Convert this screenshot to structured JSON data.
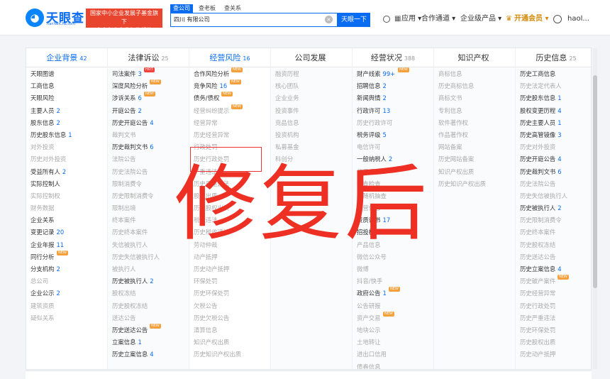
{
  "header": {
    "logo_glyph": "◕",
    "brand": "天眼查",
    "brand_sub": "TianYanCha.com",
    "badge_line1": "国家中小企业发展子基金旗下",
    "badge_line2": "官方备案企业征信机构",
    "search_tabs": [
      "查公司",
      "查老板",
      "查关系"
    ],
    "search_value": "四川                    有限公司",
    "search_button": "天眼一下",
    "nav": {
      "apps": "应用 ▾",
      "cooperation": "合作通道 ▾",
      "enterprise": "企业级产品 ▾",
      "vip": "开通会员 ▾",
      "user": "haol..."
    }
  },
  "columns": [
    {
      "title": "企业背景",
      "count": "42",
      "active": true,
      "items": [
        {
          "label": "天眼图谱"
        },
        {
          "label": "工商信息"
        },
        {
          "label": "天眼风险"
        },
        {
          "label": "主要人员",
          "count": "2"
        },
        {
          "label": "股东信息",
          "count": "2"
        },
        {
          "label": "历史股东信息",
          "count": "1"
        },
        {
          "label": "对外投资",
          "dim": true
        },
        {
          "label": "历史对外投资",
          "dim": true
        },
        {
          "label": "受益所有人",
          "count": "2"
        },
        {
          "label": "实际控制人"
        },
        {
          "label": "实际控制权",
          "dim": true
        },
        {
          "label": "财务数据",
          "dim": true
        },
        {
          "label": "企业关系"
        },
        {
          "label": "变更记录",
          "count": "20"
        },
        {
          "label": "企业年报",
          "count": "11"
        },
        {
          "label": "同行分析",
          "tag": "NEW"
        },
        {
          "label": "分支机构",
          "count": "2"
        },
        {
          "label": "总公司",
          "dim": true
        },
        {
          "label": "企业公示",
          "count": "2"
        },
        {
          "label": "建筑资质",
          "dim": true
        },
        {
          "label": "疑似关系",
          "dim": true
        }
      ]
    },
    {
      "title": "法律诉讼",
      "count": "25",
      "active": false,
      "items": [
        {
          "label": "司法案件",
          "count": "3",
          "tag": "HOT",
          "hot": true
        },
        {
          "label": "深度风险分析",
          "tag": "NEW"
        },
        {
          "label": "涉诉关系",
          "count": "6",
          "tag": "NEW"
        },
        {
          "label": "开庭公告",
          "count": "2"
        },
        {
          "label": "历史开庭公告",
          "count": "4"
        },
        {
          "label": "裁判文书",
          "dim": true
        },
        {
          "label": "历史裁判文书",
          "count": "6"
        },
        {
          "label": "法院公告",
          "dim": true
        },
        {
          "label": "历史法院公告",
          "dim": true
        },
        {
          "label": "限制消费令",
          "dim": true
        },
        {
          "label": "历史限制消费令",
          "dim": true
        },
        {
          "label": "限制出境",
          "dim": true
        },
        {
          "label": "终本案件",
          "dim": true
        },
        {
          "label": "历史终本案件",
          "dim": true
        },
        {
          "label": "失信被执行人",
          "dim": true
        },
        {
          "label": "历史失信被执行人",
          "dim": true
        },
        {
          "label": "被执行人",
          "dim": true
        },
        {
          "label": "历史被执行人",
          "count": "2"
        },
        {
          "label": "股权冻结",
          "dim": true
        },
        {
          "label": "历史股权冻结",
          "dim": true
        },
        {
          "label": "送达公告",
          "dim": true
        },
        {
          "label": "历史送达公告",
          "tag": "NEW"
        },
        {
          "label": "立案信息",
          "count": "1"
        },
        {
          "label": "历史立案信息",
          "count": "4"
        }
      ]
    },
    {
      "title": "经营风险",
      "count": "16",
      "active": true,
      "items": [
        {
          "label": "合作风险分析",
          "tag": "NEW"
        },
        {
          "label": "竞争风险",
          "count": "16",
          "tag": "NEW"
        },
        {
          "label": "债务/债权",
          "tag": "NEW"
        },
        {
          "label": "经营纠纷提示",
          "dim": true,
          "tag": "NEW"
        },
        {
          "label": "经营异常",
          "dim": true
        },
        {
          "label": "历史经营异常",
          "dim": true
        },
        {
          "label": "行政处罚",
          "dim": true
        },
        {
          "label": "历史行政处罚",
          "dim": true
        },
        {
          "label": "严重违法",
          "dim": true
        },
        {
          "label": "历史严重违法",
          "dim": true
        },
        {
          "label": "股权出质",
          "dim": true
        },
        {
          "label": "历史股权出质",
          "dim": true
        },
        {
          "label": "税收违法",
          "dim": true
        },
        {
          "label": "历史税收违法",
          "dim": true
        },
        {
          "label": "劳动仲裁",
          "dim": true
        },
        {
          "label": "动产抵押",
          "dim": true
        },
        {
          "label": "历史动产抵押",
          "dim": true
        },
        {
          "label": "环保处罚",
          "dim": true
        },
        {
          "label": "历史环保处罚",
          "dim": true
        },
        {
          "label": "欠税公告",
          "dim": true
        },
        {
          "label": "历史欠税公告",
          "dim": true
        },
        {
          "label": "清算信息",
          "dim": true
        },
        {
          "label": "知识产权出质",
          "dim": true
        },
        {
          "label": "历史知识产权出质",
          "dim": true
        }
      ]
    },
    {
      "title": "公司发展",
      "count": "",
      "active": false,
      "items": [
        {
          "label": "融资历程",
          "dim": true
        },
        {
          "label": "核心团队",
          "dim": true
        },
        {
          "label": "企业业务",
          "dim": true
        },
        {
          "label": "投资事件",
          "dim": true
        },
        {
          "label": "竞品信息",
          "dim": true
        },
        {
          "label": "投资机构",
          "dim": true
        },
        {
          "label": "私募基金",
          "dim": true
        },
        {
          "label": "科创分",
          "dim": true
        }
      ]
    },
    {
      "title": "经营状况",
      "count": "388",
      "active": false,
      "items": [
        {
          "label": "财产线索",
          "count": "99+",
          "tag": "NEW"
        },
        {
          "label": "招聘信息",
          "count": "2"
        },
        {
          "label": "新闻舆情",
          "count": "2"
        },
        {
          "label": "行政许可",
          "count": "13"
        },
        {
          "label": "历史行政许可",
          "dim": true
        },
        {
          "label": "税务评级",
          "count": "5"
        },
        {
          "label": "电信许可",
          "dim": true
        },
        {
          "label": "一般纳税人",
          "count": "2"
        },
        {
          "label": "信用评级",
          "dim": true
        },
        {
          "label": "抽查检查",
          "dim": true
        },
        {
          "label": "双随机抽查",
          "dim": true
        },
        {
          "label": "经营信息",
          "dim": true
        },
        {
          "label": "资质证书",
          "count": "17"
        },
        {
          "label": "招投标",
          "count": "8"
        },
        {
          "label": "产品信息",
          "dim": true
        },
        {
          "label": "微信公众号",
          "dim": true
        },
        {
          "label": "微博",
          "dim": true
        },
        {
          "label": "抖音/快手",
          "dim": true
        },
        {
          "label": "政府公告",
          "count": "1",
          "tag": "NEW"
        },
        {
          "label": "公告研报",
          "dim": true
        },
        {
          "label": "资产交易",
          "dim": true,
          "tag": "NEW"
        },
        {
          "label": "地块公示",
          "dim": true
        },
        {
          "label": "土地转让",
          "dim": true
        },
        {
          "label": "进出口信用",
          "dim": true
        },
        {
          "label": "债券信息",
          "dim": true
        }
      ]
    },
    {
      "title": "知识产权",
      "count": "",
      "active": false,
      "items": [
        {
          "label": "商标信息",
          "dim": true
        },
        {
          "label": "历史商标信息",
          "dim": true
        },
        {
          "label": "商标文书",
          "dim": true
        },
        {
          "label": "专利信息",
          "dim": true
        },
        {
          "label": "软件著作权",
          "dim": true
        },
        {
          "label": "作品著作权",
          "dim": true
        },
        {
          "label": "网站备案",
          "dim": true
        },
        {
          "label": "历史网站备案",
          "dim": true
        },
        {
          "label": "知识产权出质",
          "dim": true
        },
        {
          "label": "历史知识产权出质",
          "dim": true
        }
      ]
    },
    {
      "title": "历史信息",
      "count": "25",
      "active": false,
      "items": [
        {
          "label": "历史工商信息"
        },
        {
          "label": "历史法定代表人",
          "dim": true
        },
        {
          "label": "历史股东信息",
          "count": "1"
        },
        {
          "label": "股权变更历程",
          "count": "4"
        },
        {
          "label": "历史主要人员",
          "count": "1"
        },
        {
          "label": "历史高管镜像",
          "count": "3"
        },
        {
          "label": "历史对外投资",
          "dim": true
        },
        {
          "label": "历史开庭公告",
          "count": "4"
        },
        {
          "label": "历史裁判文书",
          "count": "6"
        },
        {
          "label": "历史法院公告",
          "dim": true
        },
        {
          "label": "历史失信被执行人",
          "dim": true
        },
        {
          "label": "历史被执行人",
          "count": "2"
        },
        {
          "label": "历史限制消费令",
          "dim": true
        },
        {
          "label": "历史终本案件",
          "dim": true
        },
        {
          "label": "历史股权冻结",
          "dim": true
        },
        {
          "label": "历史送达公告",
          "dim": true
        },
        {
          "label": "历史立案信息",
          "count": "4"
        },
        {
          "label": "历史破产案件",
          "dim": true,
          "tag": "NEW"
        },
        {
          "label": "历史经营异常",
          "dim": true
        },
        {
          "label": "历史行政处罚",
          "dim": true
        },
        {
          "label": "历史严重违法",
          "dim": true
        },
        {
          "label": "历史环保处罚",
          "dim": true
        },
        {
          "label": "历史股权出质",
          "dim": true
        },
        {
          "label": "历史动产抵押",
          "dim": true
        }
      ]
    }
  ],
  "overlay_text": "修复后"
}
